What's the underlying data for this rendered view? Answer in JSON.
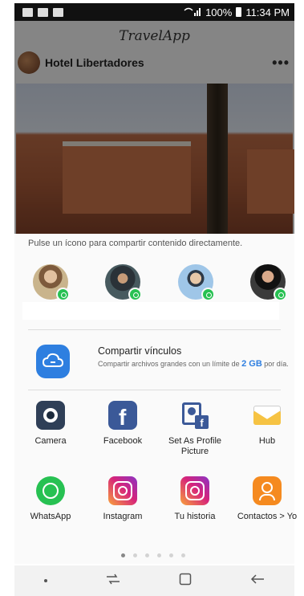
{
  "status_bar": {
    "battery_text": "100%",
    "time": "11:34 PM"
  },
  "app": {
    "brand": "TravelApp",
    "post_title": "Hotel Libertadores",
    "more_label": "•••"
  },
  "share": {
    "hint": "Pulse un ícono para compartir contenido directamente.",
    "compartir": {
      "title": "Compartir vínculos",
      "desc_prefix": "Compartir archivos grandes con un límite de ",
      "desc_limit": "2 GB",
      "desc_suffix": " por día."
    },
    "apps": [
      {
        "label": "Camera",
        "icon": "camera-icon"
      },
      {
        "label": "Facebook",
        "icon": "facebook-icon"
      },
      {
        "label": "Set As Profile Picture",
        "icon": "profile-picture-icon"
      },
      {
        "label": "Hub",
        "icon": "hub-mail-icon"
      },
      {
        "label": "WhatsApp",
        "icon": "whatsapp-icon"
      },
      {
        "label": "Instagram",
        "icon": "instagram-icon"
      },
      {
        "label": "Tu historia",
        "icon": "instagram-story-icon"
      },
      {
        "label": "Contactos > Yo",
        "icon": "contacts-icon"
      }
    ],
    "page_dots": 6,
    "active_page": 0
  },
  "colors": {
    "accent_blue": "#2e7fe0",
    "whatsapp_green": "#27c152",
    "instagram_pink": "#d6247a",
    "facebook_blue": "#3b5998",
    "contacts_orange": "#f58a1f"
  }
}
